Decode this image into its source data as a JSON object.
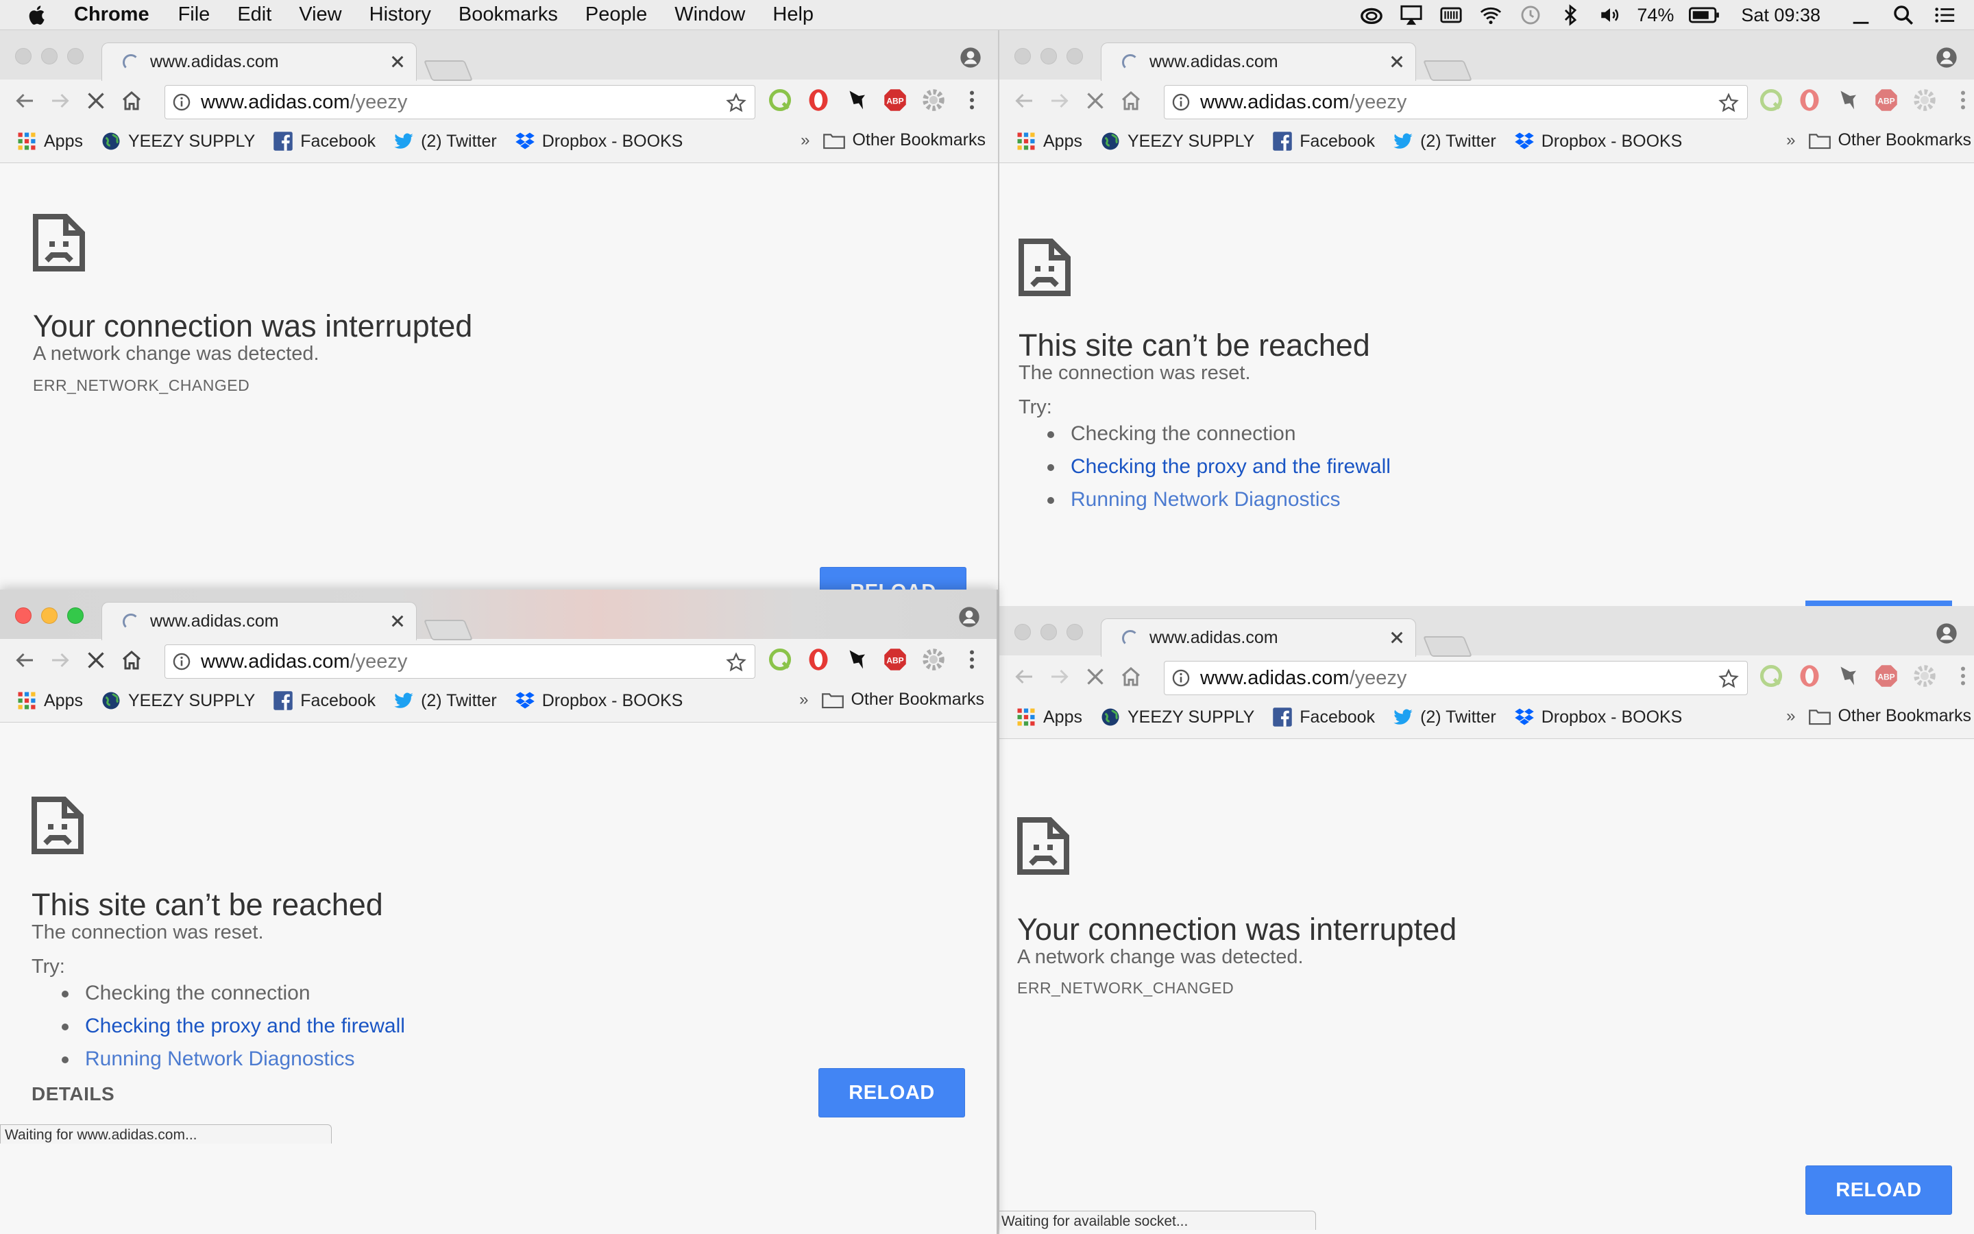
{
  "menubar": {
    "app_name": "Chrome",
    "menus": [
      "File",
      "Edit",
      "View",
      "History",
      "Bookmarks",
      "People",
      "Window",
      "Help"
    ],
    "battery": "74%",
    "clock": "Sat 09:38",
    "status_icons": [
      "creative-cloud-icon",
      "airplay-icon",
      "memory-icon",
      "wifi-icon",
      "time-machine-icon",
      "bluetooth-icon",
      "volume-icon",
      "battery-icon",
      "spotlight-icon",
      "notification-center-icon"
    ]
  },
  "browser": {
    "tab_title": "www.adidas.com",
    "url_host": "www.adidas.com",
    "url_path": "/yeezy",
    "extensions": [
      "quip-icon",
      "opera-vpn-icon",
      "bird-extension-icon",
      "abp-icon",
      "settings-gear-icon"
    ],
    "bookmarks": [
      {
        "label": "Apps",
        "icon": "apps-grid-icon"
      },
      {
        "label": "YEEZY SUPPLY",
        "icon": "globe-icon"
      },
      {
        "label": "Facebook",
        "icon": "facebook-icon"
      },
      {
        "label": "(2) Twitter",
        "icon": "twitter-icon"
      },
      {
        "label": "Dropbox - BOOKS",
        "icon": "dropbox-icon"
      }
    ],
    "overflow_chevron": "»",
    "other_bookmarks": "Other Bookmarks"
  },
  "errors": {
    "interrupted": {
      "title": "Your connection was interrupted",
      "message": "A network change was detected.",
      "code": "ERR_NETWORK_CHANGED"
    },
    "unreachable": {
      "title": "This site can’t be reached",
      "message": "The connection was reset.",
      "try_label": "Try:",
      "suggestions": [
        "Checking the connection",
        "Checking the proxy and the firewall",
        "Running Network Diagnostics"
      ]
    },
    "reload_label": "RELOAD",
    "details_label": "DETAILS"
  },
  "status_bubbles": {
    "bottom_left": "Waiting for www.adidas.com...",
    "bottom_right": "Waiting for available socket..."
  }
}
